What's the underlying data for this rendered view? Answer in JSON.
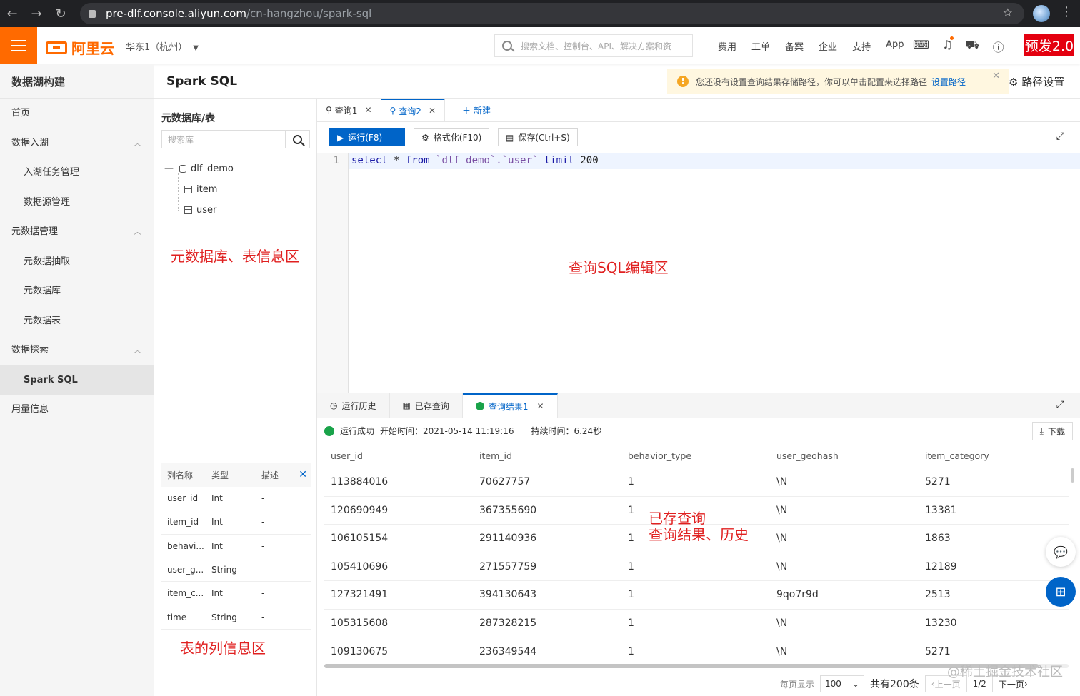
{
  "browser": {
    "url_host": "pre-dlf.console.aliyun.com",
    "url_path": "/cn-hangzhou/spark-sql"
  },
  "topbar": {
    "logo_text": "阿里云",
    "region": "华东1（杭州）",
    "search_placeholder": "搜索文档、控制台、API、解决方案和资",
    "links": [
      "费用",
      "工单",
      "备案",
      "企业",
      "支持",
      "App"
    ],
    "env_tag": "预发2.0",
    "brand_color": "#ff6a00"
  },
  "leftnav": {
    "title": "数据湖构建",
    "items": [
      {
        "label": "首页"
      },
      {
        "label": "数据入湖"
      },
      {
        "label": "入湖任务管理"
      },
      {
        "label": "数据源管理"
      },
      {
        "label": "元数据管理"
      },
      {
        "label": "元数据抽取"
      },
      {
        "label": "元数据库"
      },
      {
        "label": "元数据表"
      },
      {
        "label": "数据探索"
      },
      {
        "label": "Spark SQL"
      },
      {
        "label": "用量信息"
      }
    ]
  },
  "header": {
    "title": "Spark SQL",
    "notice_text": "您还没有设置查询结果存储路径，你可以单击配置来选择路径",
    "notice_link": "设置路径",
    "path_settings": "路径设置"
  },
  "meta": {
    "title": "元数据库/表",
    "search_placeholder": "搜索库",
    "db": "dlf_demo",
    "tables": [
      "item",
      "user"
    ],
    "annotation_db": "元数据库、表信息区",
    "columns_header": {
      "name": "列名称",
      "type": "类型",
      "desc": "描述"
    },
    "columns": [
      {
        "name": "user_id",
        "type": "Int",
        "desc": "-"
      },
      {
        "name": "item_id",
        "type": "Int",
        "desc": "-"
      },
      {
        "name": "behavi...",
        "type": "Int",
        "desc": "-"
      },
      {
        "name": "user_g...",
        "type": "String",
        "desc": "-"
      },
      {
        "name": "item_c...",
        "type": "Int",
        "desc": "-"
      },
      {
        "name": "time",
        "type": "String",
        "desc": "-"
      }
    ],
    "annotation_cols": "表的列信息区"
  },
  "editor": {
    "tabs": [
      {
        "label": "查询1"
      },
      {
        "label": "查询2"
      }
    ],
    "new_tab": "新建",
    "run": "运行(F8)",
    "format": "格式化(F10)",
    "save": "保存(Ctrl+S)",
    "line_no": "1",
    "sql": {
      "select": "select",
      "star": " * ",
      "from": "from",
      "table": " `dlf_demo`.`user` ",
      "limit": "limit",
      "num": " 200"
    },
    "annotation": "查询SQL编辑区"
  },
  "results": {
    "tabs": [
      "运行历史",
      "已存查询",
      "查询结果1"
    ],
    "status_text": "运行成功",
    "start_time": "开始时间：2021-05-14 11:19:16",
    "duration": "持续时间：6.24秒",
    "download": "下载",
    "columns": [
      "user_id",
      "item_id",
      "behavior_type",
      "user_geohash",
      "item_category"
    ],
    "rows": [
      [
        "113884016",
        "70627757",
        "1",
        "\\N",
        "5271"
      ],
      [
        "120690949",
        "367355690",
        "1",
        "\\N",
        "13381"
      ],
      [
        "106105154",
        "291140936",
        "1",
        "\\N",
        "1863"
      ],
      [
        "105410696",
        "271557759",
        "1",
        "\\N",
        "12189"
      ],
      [
        "127321491",
        "394130643",
        "1",
        "9qo7r9d",
        "2513"
      ],
      [
        "105315608",
        "287328215",
        "1",
        "\\N",
        "13230"
      ],
      [
        "109130675",
        "236349544",
        "1",
        "\\N",
        "5271"
      ]
    ],
    "annotation_line1": "已存查询",
    "annotation_line2": "查询结果、历史",
    "page_size_label": "每页显示",
    "page_size": "100",
    "total": "共有200条",
    "prev": "上一页",
    "page": "1/2",
    "next": "下一页",
    "watermark": "@稀土掘金技术社区"
  }
}
